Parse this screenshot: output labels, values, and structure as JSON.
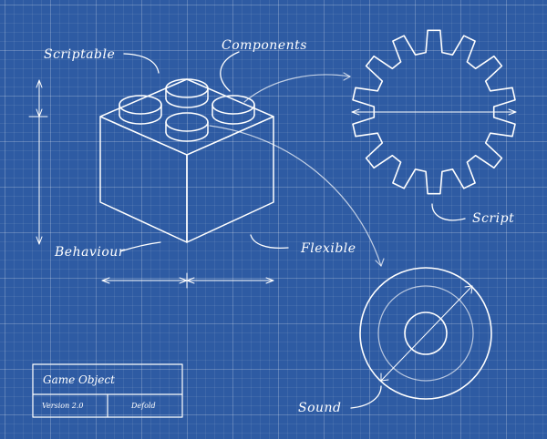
{
  "colors": {
    "background": "#2e5ba3",
    "ink": "#ffffff"
  },
  "labels": {
    "scriptable": "Scriptable",
    "components": "Components",
    "behaviour": "Behaviour",
    "flexible": "Flexible",
    "script": "Script",
    "sound": "Sound"
  },
  "title_block": {
    "title": "Game Object",
    "version": "Version 2.0",
    "author": "Defold"
  }
}
